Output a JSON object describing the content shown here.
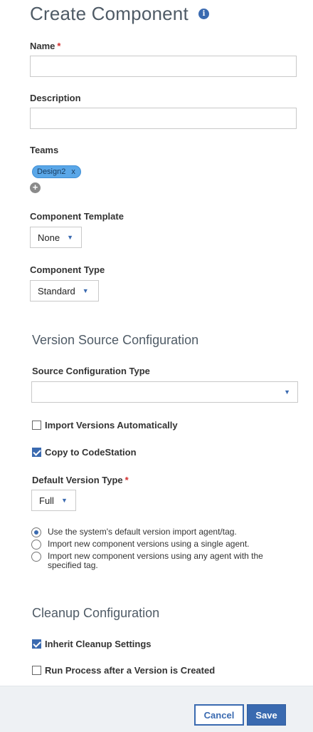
{
  "header": {
    "title": "Create Component",
    "info_icon": "info-icon"
  },
  "form": {
    "name": {
      "label": "Name",
      "required": "*",
      "value": ""
    },
    "description": {
      "label": "Description",
      "value": ""
    },
    "teams": {
      "label": "Teams",
      "tags": [
        {
          "label": "Design2",
          "remove": "x"
        }
      ],
      "add_icon": "plus-circle-icon"
    },
    "component_template": {
      "label": "Component Template",
      "selected": "None"
    },
    "component_type": {
      "label": "Component Type",
      "selected": "Standard"
    }
  },
  "version_source": {
    "title": "Version Source Configuration",
    "source_type": {
      "label": "Source Configuration Type",
      "selected": ""
    },
    "import_auto": {
      "label": "Import Versions Automatically",
      "checked": false
    },
    "copy_codestation": {
      "label": "Copy to CodeStation",
      "checked": true
    },
    "default_version_type": {
      "label": "Default Version Type",
      "required": "*",
      "selected": "Full"
    },
    "import_options": [
      {
        "label": "Use the system's default version import agent/tag.",
        "checked": true
      },
      {
        "label": "Import new component versions using a single agent.",
        "checked": false
      },
      {
        "label": "Import new component versions using any agent with the specified tag.",
        "checked": false
      }
    ]
  },
  "cleanup": {
    "title": "Cleanup Configuration",
    "inherit": {
      "label": "Inherit Cleanup Settings",
      "checked": true
    },
    "run_process": {
      "label": "Run Process after a Version is Created",
      "checked": false
    }
  },
  "footer": {
    "cancel_label": "Cancel",
    "save_label": "Save"
  },
  "colors": {
    "accent": "#3a6ab0",
    "tag_bg": "#5aa7e8",
    "required": "#d32f2f",
    "footer_bg": "#eef1f4"
  }
}
